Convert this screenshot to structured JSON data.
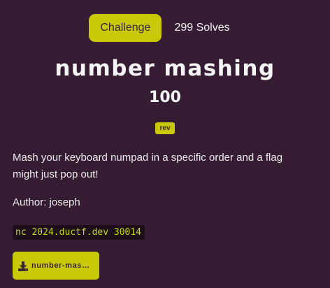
{
  "tabs": {
    "challenge_label": "Challenge",
    "solves_label": "299 Solves"
  },
  "challenge": {
    "name": "number mashing",
    "points": "100",
    "tag": "rev",
    "description": "Mash your keyboard numpad in a specific order and a flag might just pop out!",
    "author": "Author: joseph",
    "connection": "nc 2024.ductf.dev 30014",
    "file_label": "number-mashing"
  },
  "icons": {
    "download": "download-icon"
  },
  "colors": {
    "background": "#361c33",
    "accent": "#c9c905",
    "accent_text": "#3a2436",
    "code_background": "#1d0e1b",
    "code_text": "#c7d61b"
  }
}
